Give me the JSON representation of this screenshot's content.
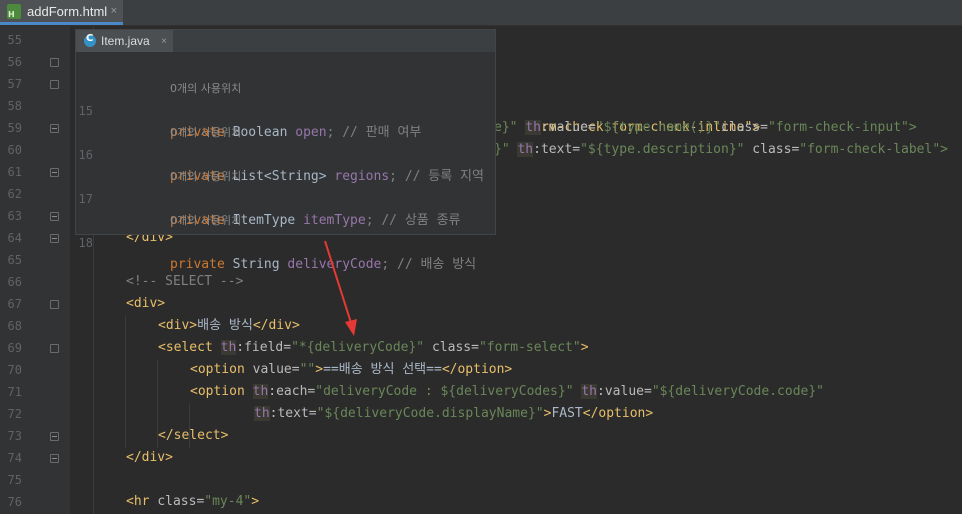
{
  "tab": {
    "filename": "addForm.html",
    "close": "×"
  },
  "popup": {
    "tab_label": "Item.java",
    "close": "×",
    "lines": [
      {
        "num": "",
        "kind": "usage",
        "text": "0개의 사용위치"
      },
      {
        "num": "15",
        "kind": "code",
        "kw": "private",
        "type": " Boolean ",
        "field": "open",
        "rest": "; // 판매 여부"
      },
      {
        "num": "",
        "kind": "usage",
        "text": "0개의 사용위치"
      },
      {
        "num": "16",
        "kind": "code",
        "kw": "private",
        "type": " List<String> ",
        "field": "regions",
        "rest": "; // 등록 지역"
      },
      {
        "num": "",
        "kind": "usage",
        "text": "0개의 사용위치"
      },
      {
        "num": "17",
        "kind": "code",
        "kw": "private",
        "type": " ItemType ",
        "field": "itemType",
        "rest": "; // 상품 종류"
      },
      {
        "num": "",
        "kind": "usage",
        "text": "0개의 사용위치"
      },
      {
        "num": "18",
        "kind": "code",
        "kw": "private",
        "type": " String ",
        "field": "deliveryCode",
        "rest": "; // 배송 방식"
      }
    ]
  },
  "gutter": {
    "line_numbers": [
      "55",
      "56",
      "57",
      "58",
      "59",
      "60",
      "61",
      "62",
      "63",
      "64",
      "65",
      "66",
      "67",
      "68",
      "69",
      "70",
      "71",
      "72",
      "73",
      "74",
      "75",
      "76"
    ]
  },
  "code": {
    "l57_partial": "form-check form-check-inline\">",
    "l58_pre": "e}\" ",
    "l58_th": "th",
    "l58_attr": ":value=",
    "l58_val": "\"${type.name()}\"",
    "l58_class": "class=",
    "l58_classval": "\"form-check-input\">",
    "l59_pre": "}\" ",
    "l59_th": "th",
    "l59_attr": ":text=",
    "l59_val": "\"${type.description}\"",
    "l59_class": " class=",
    "l59_classval": "\"form-check-label\">",
    "l64": "</div>",
    "l66": "<!-- SELECT -->",
    "l67": "<div>",
    "l68_open": "<div>",
    "l68_text": "배송 방식",
    "l68_close": "</div>",
    "l69_tag": "<select ",
    "l69_th": "th",
    "l69_attr": ":field=",
    "l69_val": "\"*{deliveryCode}\"",
    "l69_class": " class=",
    "l69_classval": "\"form-select\"",
    "l69_end": ">",
    "l70_tag": "<option ",
    "l70_attr": "value=",
    "l70_val": "\"\"",
    "l70_gt": ">",
    "l70_text": "==배송 방식 선택==",
    "l70_close": "</option>",
    "l71_tag": "<option ",
    "l71_th": "th",
    "l71_attr": ":each=",
    "l71_val": "\"deliveryCode : ${deliveryCodes}\"",
    "l71_th2": "th",
    "l71_attr2": ":value=",
    "l71_val2": "\"${deliveryCode.code}\"",
    "l72_th": "th",
    "l72_attr": ":text=",
    "l72_val": "\"${deliveryCode.displayName}\"",
    "l72_gt": ">",
    "l72_text": "FAST",
    "l72_close": "</option>",
    "l73": "</select>",
    "l74": "</div>",
    "l76_tag": "<hr ",
    "l76_attr": "class=",
    "l76_val": "\"my-4\"",
    "l76_end": ">"
  },
  "colors": {
    "background": "#2b2b2b",
    "tag": "#e8bf6a",
    "string": "#6a8759",
    "keyword": "#cc7832",
    "field": "#9876aa",
    "comment": "#808080",
    "arrow": "#e53935"
  }
}
